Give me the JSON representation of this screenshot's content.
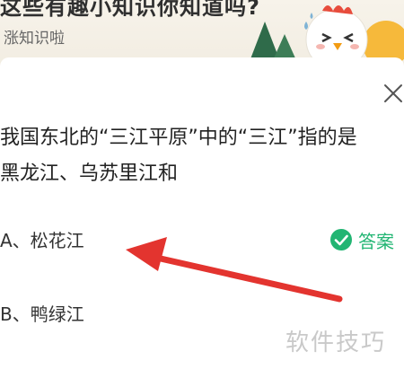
{
  "banner": {
    "title": "这些有趣小知识你知道吗?",
    "subtitle": "涨知识啦"
  },
  "question": {
    "line1": "我国东北的“三江平原”中的“三江”指的是",
    "line2": "黑龙江、乌苏里江和"
  },
  "options": [
    {
      "label": "A、松花江",
      "is_answer": true
    },
    {
      "label": "B、鸭绿江",
      "is_answer": false
    }
  ],
  "answer": {
    "label": "答案",
    "color": "#22b573"
  },
  "annotation": {
    "arrow_color": "#e3342f"
  },
  "icons": {
    "close": "close-icon",
    "check": "check-circle-icon"
  },
  "watermark": "软件技巧"
}
